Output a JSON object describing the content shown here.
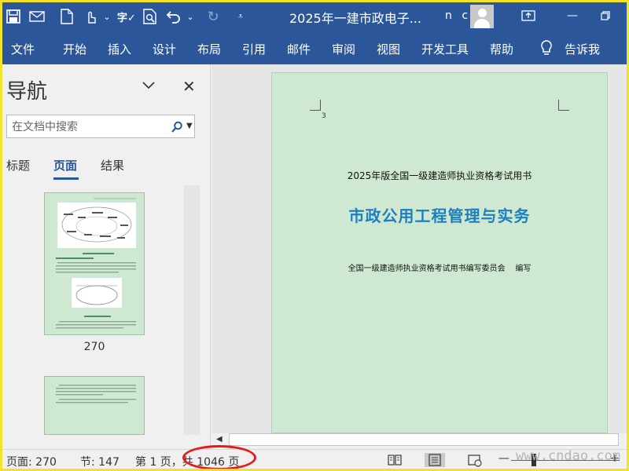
{
  "titlebar": {
    "document_title": "2025年一建市政电子...",
    "user_name": "n c",
    "qat_icons": [
      "save-icon",
      "new-document-icon",
      "touch-mode-icon",
      "spelling-icon",
      "print-preview-icon",
      "undo-icon",
      "redo-icon",
      "customize-qat-icon"
    ]
  },
  "ribbon": {
    "tabs": [
      "文件",
      "开始",
      "插入",
      "设计",
      "布局",
      "引用",
      "邮件",
      "审阅",
      "视图",
      "开发工具",
      "帮助"
    ],
    "tell_me": "告诉我"
  },
  "nav": {
    "title": "导航",
    "search_placeholder": "在文档中搜索",
    "tabs": [
      "标题",
      "页面",
      "结果"
    ],
    "active_tab": "页面",
    "thumb_page_number": "270"
  },
  "document": {
    "page_number": "3",
    "subtitle": "2025年版全国一级建造师执业资格考试用书",
    "main_title": "市政公用工程管理与实务",
    "editors": "全国一级建造师执业资格考试用书编写委员会    编写"
  },
  "status": {
    "page": "页面: 270",
    "section": "节: 147",
    "page_of": "第 1 页，共 1046 页",
    "watermark": "www.cndao.com"
  },
  "colors": {
    "ribbon_blue": "#2b579a",
    "page_green": "#cfe8d1",
    "title_blue": "#1e7fc0",
    "annotation_red": "#e41b1b",
    "frame_yellow": "#f2e22a"
  }
}
